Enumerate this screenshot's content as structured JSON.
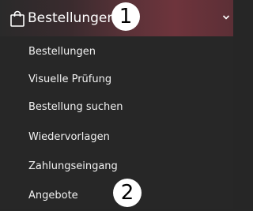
{
  "menu": {
    "section_label": "Bestellungen",
    "section_icon": "shopping-bag-icon",
    "expand_icon": "chevron-down-icon",
    "items": [
      {
        "label": "Bestellungen"
      },
      {
        "label": "Visuelle Prüfung"
      },
      {
        "label": "Bestellung suchen"
      },
      {
        "label": "Wiedervorlagen"
      },
      {
        "label": "Zahlungseingang"
      },
      {
        "label": "Angebote"
      }
    ]
  },
  "annotations": {
    "badge_1": "1",
    "badge_2": "2"
  }
}
